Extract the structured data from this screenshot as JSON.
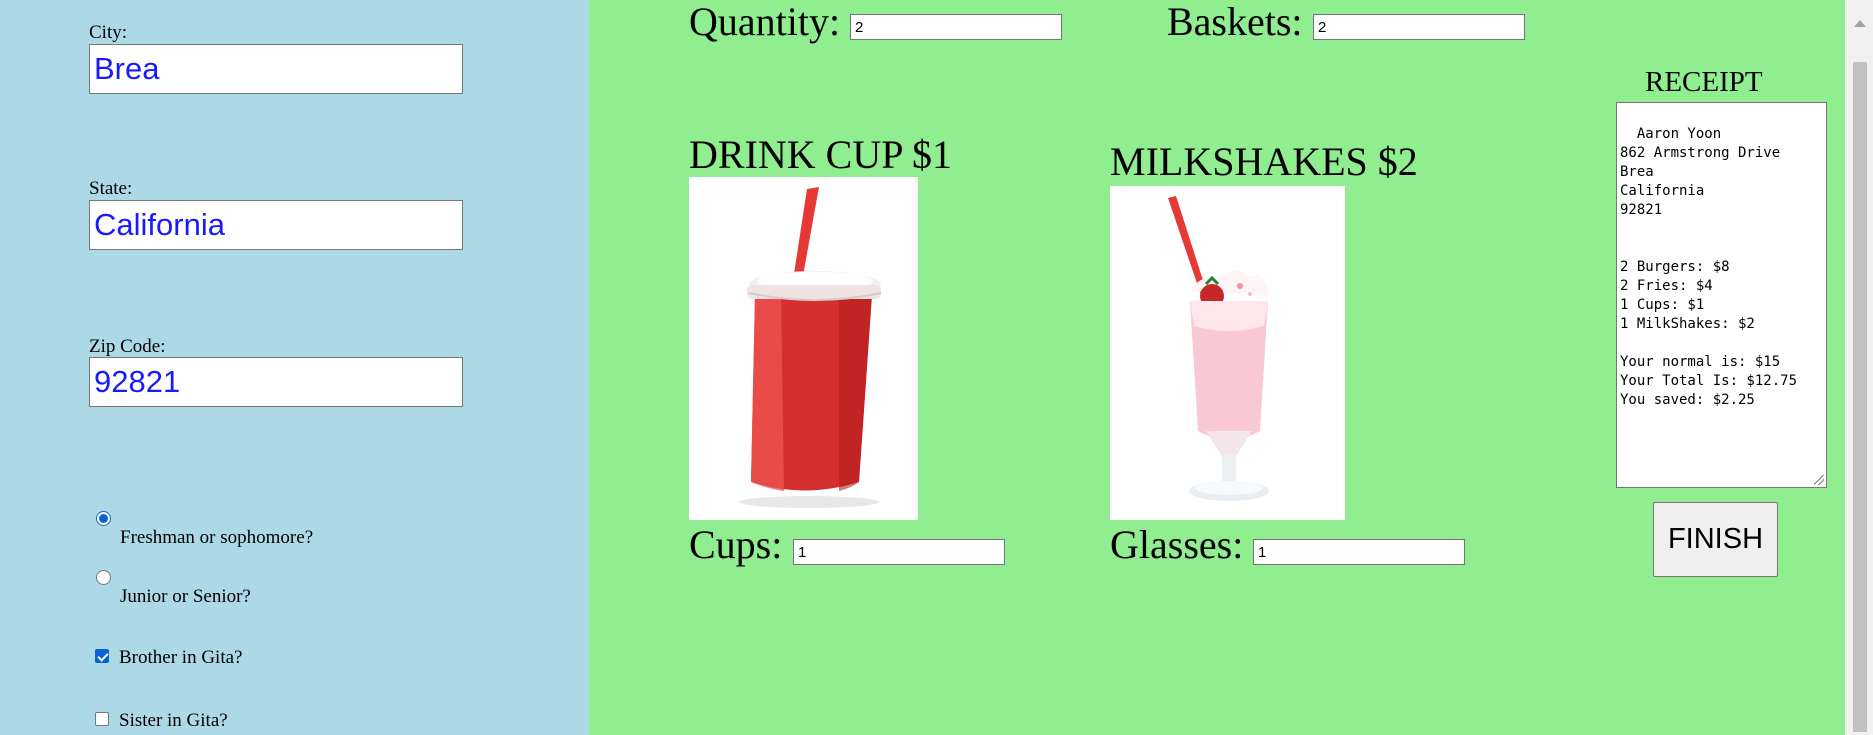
{
  "form": {
    "city": {
      "label": "City:",
      "value": "Brea"
    },
    "state": {
      "label": "State:",
      "value": "California"
    },
    "zip": {
      "label": "Zip Code:",
      "value": "92821"
    },
    "radio_freshman": {
      "label": "Freshman or sophomore?",
      "checked": true
    },
    "radio_junior": {
      "label": "Junior or Senior?",
      "checked": false
    },
    "check_brother": {
      "label": "Brother in Gita?",
      "checked": true
    },
    "check_sister": {
      "label": "Sister in Gita?",
      "checked": false
    }
  },
  "order": {
    "quantity": {
      "label": "Quantity:",
      "value": "2"
    },
    "baskets": {
      "label": "Baskets:",
      "value": "2"
    },
    "drink": {
      "title": "DRINK CUP $1",
      "qty_label": "Cups:",
      "qty_value": "1",
      "image_icon": "red-drink-cup"
    },
    "shake": {
      "title": "MILKSHAKES $2",
      "qty_label": "Glasses:",
      "qty_value": "1",
      "image_icon": "strawberry-milkshake"
    }
  },
  "receipt": {
    "title": "RECEIPT",
    "text": "Aaron Yoon\n862 Armstrong Drive\nBrea\nCalifornia\n92821\n\n\n2 Burgers: $8\n2 Fries: $4\n1 Cups: $1\n1 MilkShakes: $2\n\nYour normal is: $15\nYour Total Is: $12.75\nYou saved: $2.25",
    "finish_label": "FINISH"
  },
  "colors": {
    "left_bg": "#add8e6",
    "right_bg": "#90ee90",
    "input_text": "#1a1aff"
  }
}
